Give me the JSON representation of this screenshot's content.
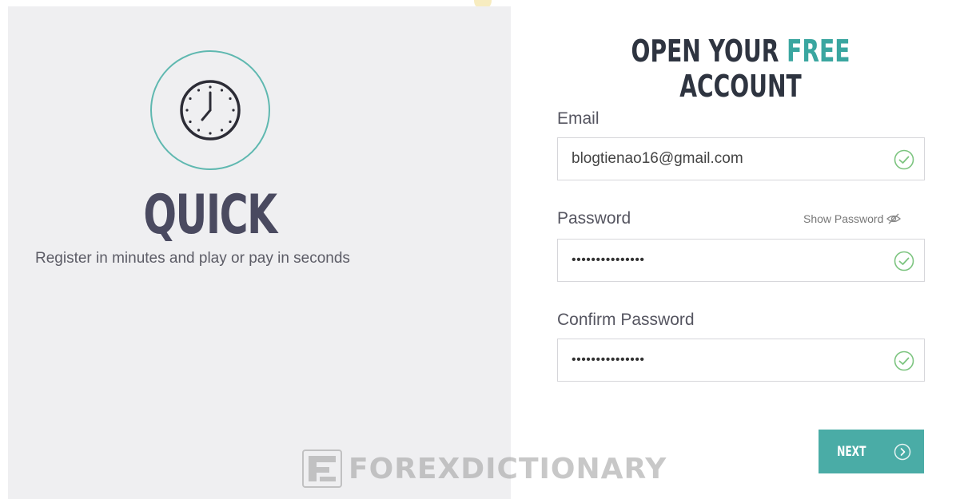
{
  "left": {
    "headline": "QUICK",
    "subline": "Register in minutes and play or pay in seconds",
    "icon": "clock-icon"
  },
  "form": {
    "title_part1": "OPEN YOUR ",
    "title_accent": "FREE",
    "title_part2": " ACCOUNT",
    "email_label": "Email",
    "email_value": "blogtienao16@gmail.com",
    "password_label": "Password",
    "show_password_label": "Show Password",
    "password_value": "•••••••••••••••",
    "confirm_label": "Confirm Password",
    "confirm_value": "•••••••••••••••",
    "next_label": "NEXT"
  },
  "watermark": {
    "text": "FOREXDICTIONARY"
  },
  "colors": {
    "accent": "#4aaca6",
    "ring": "#5fb8b0",
    "check": "#7cc47f",
    "left_bg": "#efeff1",
    "headline": "#4a4a60"
  }
}
